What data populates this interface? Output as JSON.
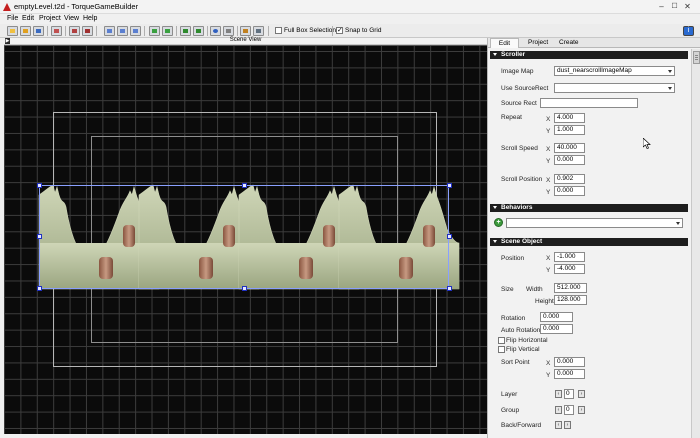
{
  "window": {
    "title": "emptyLevel.t2d - TorqueGameBuilder",
    "controls": {
      "minimize": "–",
      "maximize": "☐",
      "close": "✕"
    }
  },
  "menu": [
    "File",
    "Edit",
    "Project",
    "View",
    "Help"
  ],
  "toolbar": {
    "full_box_selection": {
      "label": "Full Box Selection",
      "checked": false
    },
    "snap_to_grid": {
      "label": "Snap to Grid",
      "checked": true
    },
    "help_label": "i"
  },
  "scene": {
    "title": "Scene View",
    "arrow": "▶",
    "grid_color": "#3c3c3c",
    "background": "#0b0b0b"
  },
  "sidebar": {
    "tabs": [
      "Edit",
      "Project",
      "Create"
    ],
    "active_tab": "Edit",
    "sections": {
      "scroller": {
        "title": "Scroller",
        "image_map_label": "Image Map",
        "image_map_value": "dust_nearscrollImageMap",
        "use_source_rect_label": "Use SourceRect",
        "use_source_rect_value": "",
        "source_rect_label": "Source Rect",
        "source_rect_value": "",
        "repeat_label": "Repeat",
        "repeat_x": "4.000",
        "repeat_y": "1.000",
        "scroll_speed_label": "Scroll Speed",
        "scroll_speed_x": "40.000",
        "scroll_speed_y": "0.000",
        "scroll_position_label": "Scroll Position",
        "scroll_position_x": "0.902",
        "scroll_position_y": "0.000"
      },
      "behaviors": {
        "title": "Behaviors",
        "add_label": "+",
        "selected": ""
      },
      "scene_object": {
        "title": "Scene Object",
        "position_label": "Position",
        "position_x": "-1.000",
        "position_y": "-4.000",
        "size_label": "Size",
        "width_label": "Width",
        "width_value": "512.000",
        "height_label": "Height",
        "height_value": "128.000",
        "rotation_label": "Rotation",
        "rotation_value": "0.000",
        "auto_rotation_label": "Auto Rotation",
        "auto_rotation_value": "0.000",
        "flip_horizontal_label": "Flip Horizontal",
        "flip_vertical_label": "Flip Vertical",
        "sort_point_label": "Sort Point",
        "sort_point_x": "0.000",
        "sort_point_y": "0.000",
        "layer_label": "Layer",
        "layer_value": "0",
        "group_label": "Group",
        "group_value": "0",
        "back_forward_label": "Back/Forward"
      }
    },
    "axis_x": "X",
    "axis_y": "Y"
  }
}
